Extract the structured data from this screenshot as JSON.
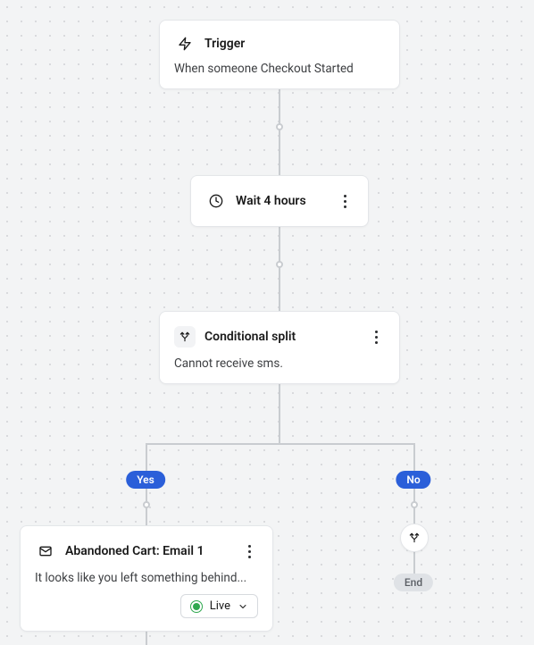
{
  "trigger": {
    "title": "Trigger",
    "description": "When someone Checkout Started"
  },
  "wait": {
    "label": "Wait 4 hours"
  },
  "conditional": {
    "title": "Conditional split",
    "description": "Cannot receive sms."
  },
  "branches": {
    "yes_label": "Yes",
    "no_label": "No"
  },
  "email": {
    "title": "Abandoned Cart: Email 1",
    "preview": "It looks like you left something behind...",
    "status": "Live"
  },
  "end": {
    "label": "End"
  }
}
